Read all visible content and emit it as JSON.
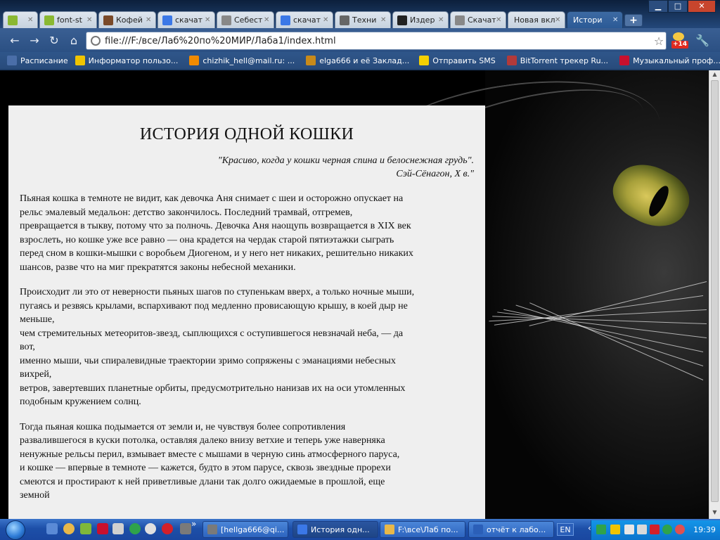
{
  "browser": {
    "tabs": [
      {
        "label": "",
        "icon": "m-icon",
        "color": "#8ab832"
      },
      {
        "label": "font-st",
        "icon": "m-icon",
        "color": "#8ab832"
      },
      {
        "label": "Кофей",
        "icon": "coffee-icon",
        "color": "#7a4a2a"
      },
      {
        "label": "скачат",
        "icon": "google-icon",
        "color": "#3b78e7"
      },
      {
        "label": "Себест",
        "icon": "globe-icon",
        "color": "#888888"
      },
      {
        "label": "скачат",
        "icon": "google-icon",
        "color": "#3b78e7"
      },
      {
        "label": "Техни",
        "icon": "star-icon",
        "color": "#666666"
      },
      {
        "label": "Издер",
        "icon": "a-icon",
        "color": "#222222"
      },
      {
        "label": "Скачат",
        "icon": "globe-icon",
        "color": "#888888"
      },
      {
        "label": "Новая вкл",
        "icon": "",
        "color": "#cccccc"
      },
      {
        "label": "Истори",
        "icon": "",
        "color": "#cccccc",
        "active": true
      }
    ],
    "new_tab": "+",
    "url": "file:///F:/все/Лаб%20по%20МИР/Лаба1/index.html",
    "extension_badge": "+14",
    "bookmarks": [
      {
        "label": "Расписание",
        "color": "#4a6ea8"
      },
      {
        "label": "Информатор пользо...",
        "color": "#f0c400"
      },
      {
        "label": "chizhik_hell@mail.ru: ...",
        "color": "#f08a00"
      },
      {
        "label": "elga666 и её Заклад...",
        "color": "#c88a1a"
      },
      {
        "label": "Отправить SMS",
        "color": "#f5d000"
      },
      {
        "label": "BitTorrent трекер Ru...",
        "color": "#b23a3a"
      },
      {
        "label": "Музыкальный проф...",
        "color": "#c8102e"
      }
    ]
  },
  "page": {
    "title": "ИСТОРИЯ ОДНОЙ КОШКИ",
    "epigraph_quote": "\"Красиво, когда у кошки черная спина и белоснежная грудь\".",
    "epigraph_author": "Сэй-Сёнагон, X в.\"",
    "paragraphs": [
      [
        "Пьяная кошка в темноте не видит, как девочка Аня снимает с шеи и осторожно опускает на",
        "рельс эмалевый медальон: детство закончилось. Последний трамвай, отгремев,",
        "превращается в тыкву, потому что за полночь. Девочка Аня наощупь возвращается в XIX век",
        "взрослеть, но кошке уже все равно — она крадется на чердак старой пятиэтажки сыграть",
        "перед сном в кошки-мышки с воробьем Диогеном, и у него нет никаких, решительно никаких",
        "шансов, разве что на миг прекратятся законы небесной механики."
      ],
      [
        "Происходит ли это от неверности пьяных шагов по ступенькам вверх, а только ночные мыши,",
        "пугаясь и резвясь крылами, вспархивают под медленно провисающую крышу, в коей дыр не",
        "меньше,",
        "чем стремительных метеоритов-звезд, сыплющихся с оступившегося невзначай неба, — да",
        "вот,",
        "именно мыши, чьи спиралевидные траектории зримо сопряжены с эманациями небесных",
        "вихрей,",
        "ветров, завертевших планетные орбиты, предусмотрительно нанизав их на оси утомленных",
        "подобным кружением солнц."
      ],
      [
        "Тогда пьяная кошка подымается от земли и, не чувствуя более сопротивления",
        "развалившегося в куски потолка, оставляя далеко внизу ветхие и теперь уже наверняка",
        "ненужные рельсы перил, взмывает вместе с мышами в черную синь атмосферного паруса,",
        "и кошке — впервые в темноте — кажется, будто в этом парусе, сквозь звездные прорехи",
        "смеются и простирают к ней приветливые длани так долго ожидаемые в прошлой, еще",
        "земной"
      ]
    ]
  },
  "taskbar": {
    "tasks": [
      {
        "label": "[hellga666@qi...",
        "color": "#7a7a7a"
      },
      {
        "label": "История одн...",
        "color": "#3b78e7",
        "active": true
      },
      {
        "label": "F:\\все\\Лаб по...",
        "color": "#e8b84a"
      },
      {
        "label": "отчёт к лабо...",
        "color": "#2b5fb8"
      }
    ],
    "language": "EN",
    "clock": "19:39",
    "chevron": "»"
  }
}
